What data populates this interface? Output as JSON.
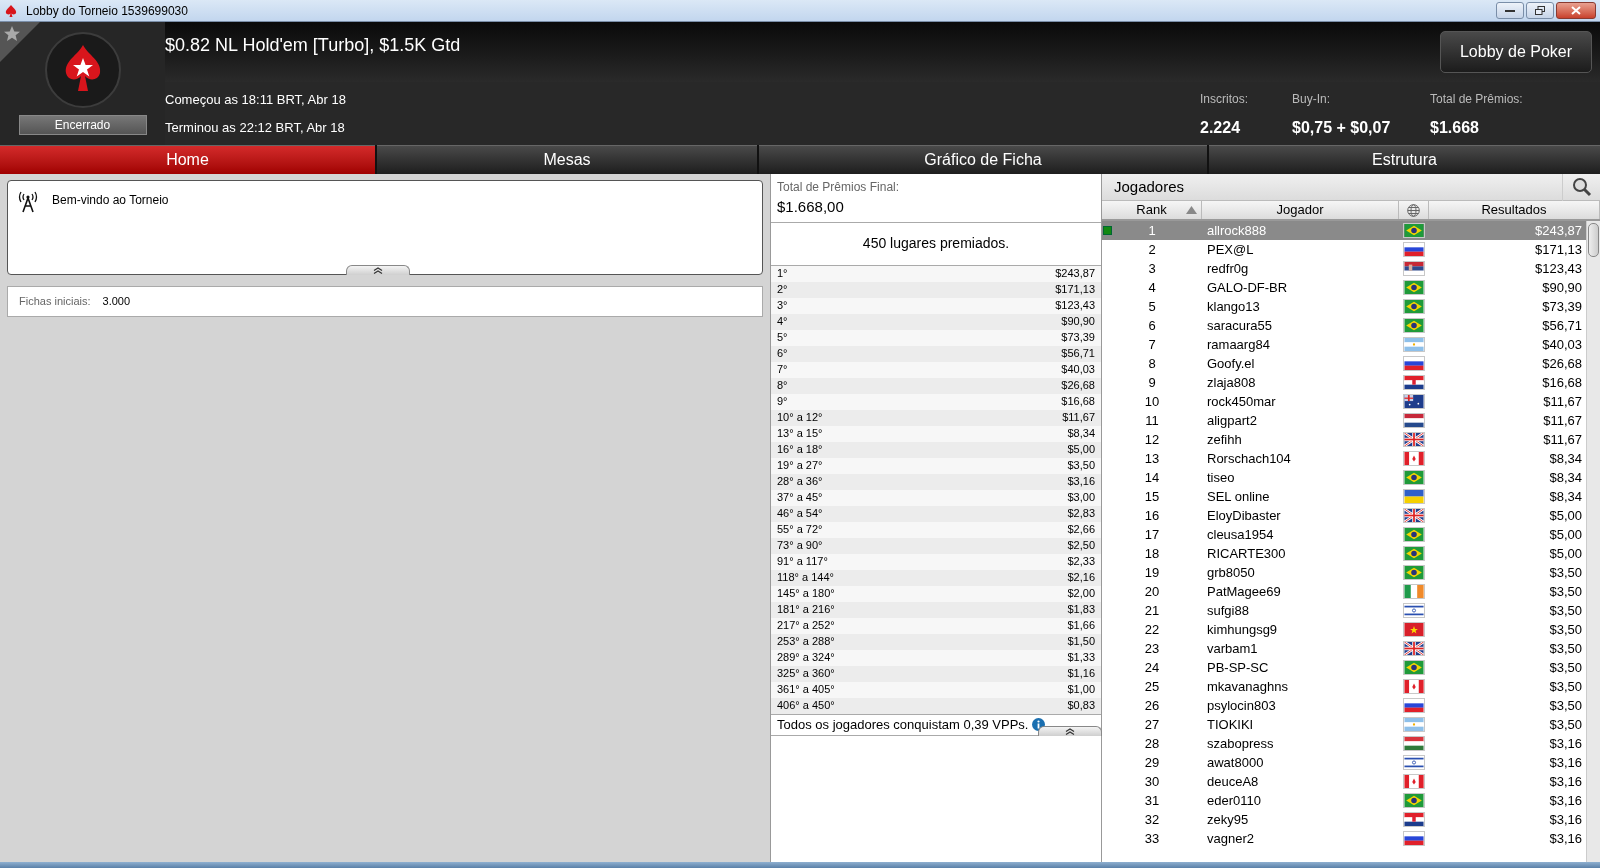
{
  "window": {
    "title": "Lobby do Torneio 1539699030"
  },
  "header": {
    "title": "$0.82 NL Hold'em [Turbo], $1.5K Gtd",
    "status": "Encerrado",
    "started": "Começou as 18:11 BRT, Abr 18",
    "ended": "Terminou as 22:12 BRT, Abr 18",
    "lobby_button": "Lobby de Poker",
    "stats": [
      {
        "label": "Inscritos:",
        "value": "2.224"
      },
      {
        "label": "Buy-In:",
        "value": "$0,75 + $0,07"
      },
      {
        "label": "Total de Prêmios:",
        "value": "$1.668"
      }
    ]
  },
  "tabs": [
    {
      "label": "Home",
      "selected": true
    },
    {
      "label": "Mesas",
      "selected": false
    },
    {
      "label": "Gráfico de Ficha",
      "selected": false
    },
    {
      "label": "Estrutura",
      "selected": false
    }
  ],
  "welcome": {
    "message": "Bem-vindo ao Torneio"
  },
  "starting_chips": {
    "label": "Fichas iniciais:",
    "value": "3.000"
  },
  "prizes": {
    "total_label": "Total de Prêmios Final:",
    "total_value": "$1.668,00",
    "places_text": "450 lugares premiados.",
    "footer": "Todos os jogadores conquistam 0,39 VPPs.",
    "rows": [
      {
        "place": "1°",
        "amount": "$243,87"
      },
      {
        "place": "2°",
        "amount": "$171,13"
      },
      {
        "place": "3°",
        "amount": "$123,43"
      },
      {
        "place": "4°",
        "amount": "$90,90"
      },
      {
        "place": "5°",
        "amount": "$73,39"
      },
      {
        "place": "6°",
        "amount": "$56,71"
      },
      {
        "place": "7°",
        "amount": "$40,03"
      },
      {
        "place": "8°",
        "amount": "$26,68"
      },
      {
        "place": "9°",
        "amount": "$16,68"
      },
      {
        "place": "10° a 12°",
        "amount": "$11,67"
      },
      {
        "place": "13° a 15°",
        "amount": "$8,34"
      },
      {
        "place": "16° a 18°",
        "amount": "$5,00"
      },
      {
        "place": "19° a 27°",
        "amount": "$3,50"
      },
      {
        "place": "28° a 36°",
        "amount": "$3,16"
      },
      {
        "place": "37° a 45°",
        "amount": "$3,00"
      },
      {
        "place": "46° a 54°",
        "amount": "$2,83"
      },
      {
        "place": "55° a 72°",
        "amount": "$2,66"
      },
      {
        "place": "73° a 90°",
        "amount": "$2,50"
      },
      {
        "place": "91° a 117°",
        "amount": "$2,33"
      },
      {
        "place": "118° a 144°",
        "amount": "$2,16"
      },
      {
        "place": "145° a 180°",
        "amount": "$2,00"
      },
      {
        "place": "181° a 216°",
        "amount": "$1,83"
      },
      {
        "place": "217° a 252°",
        "amount": "$1,66"
      },
      {
        "place": "253° a 288°",
        "amount": "$1,50"
      },
      {
        "place": "289° a 324°",
        "amount": "$1,33"
      },
      {
        "place": "325° a 360°",
        "amount": "$1,16"
      },
      {
        "place": "361° a 405°",
        "amount": "$1,00"
      },
      {
        "place": "406° a 450°",
        "amount": "$0,83"
      }
    ]
  },
  "players": {
    "title": "Jogadores",
    "columns": [
      {
        "kind": "text",
        "label": "Rank",
        "sorted": true
      },
      {
        "kind": "text",
        "label": "Jogador",
        "sorted": false
      },
      {
        "kind": "icon",
        "sorted": false
      },
      {
        "kind": "text",
        "label": "Resultados",
        "sorted": false
      }
    ],
    "rows": [
      {
        "rank": "1",
        "name": "allrock888",
        "flag": {
          "kind": "br"
        },
        "result": "$243,87",
        "selected": true
      },
      {
        "rank": "2",
        "name": "PEX@L",
        "flag": {
          "kind": "ru"
        },
        "result": "$171,13",
        "selected": false
      },
      {
        "rank": "3",
        "name": "redfr0g",
        "flag": {
          "kind": "rs"
        },
        "result": "$123,43",
        "selected": false
      },
      {
        "rank": "4",
        "name": "GALO-DF-BR",
        "flag": {
          "kind": "br"
        },
        "result": "$90,90",
        "selected": false
      },
      {
        "rank": "5",
        "name": "klango13",
        "flag": {
          "kind": "br"
        },
        "result": "$73,39",
        "selected": false
      },
      {
        "rank": "6",
        "name": "saracura55",
        "flag": {
          "kind": "br"
        },
        "result": "$56,71",
        "selected": false
      },
      {
        "rank": "7",
        "name": "ramaarg84",
        "flag": {
          "kind": "ar"
        },
        "result": "$40,03",
        "selected": false
      },
      {
        "rank": "8",
        "name": "Goofy.el",
        "flag": {
          "kind": "ru"
        },
        "result": "$26,68",
        "selected": false
      },
      {
        "rank": "9",
        "name": "zlaja808",
        "flag": {
          "kind": "hr"
        },
        "result": "$16,68",
        "selected": false
      },
      {
        "rank": "10",
        "name": "rock450mar",
        "flag": {
          "kind": "au"
        },
        "result": "$11,67",
        "selected": false
      },
      {
        "rank": "11",
        "name": "aligpart2",
        "flag": {
          "kind": "nl"
        },
        "result": "$11,67",
        "selected": false
      },
      {
        "rank": "12",
        "name": "zefihh",
        "flag": {
          "kind": "gb"
        },
        "result": "$11,67",
        "selected": false
      },
      {
        "rank": "13",
        "name": "Rorschach104",
        "flag": {
          "kind": "ca"
        },
        "result": "$8,34",
        "selected": false
      },
      {
        "rank": "14",
        "name": "tiseo",
        "flag": {
          "kind": "br"
        },
        "result": "$8,34",
        "selected": false
      },
      {
        "rank": "15",
        "name": "SEL online",
        "flag": {
          "kind": "ua"
        },
        "result": "$8,34",
        "selected": false
      },
      {
        "rank": "16",
        "name": "EloyDibaster",
        "flag": {
          "kind": "gb"
        },
        "result": "$5,00",
        "selected": false
      },
      {
        "rank": "17",
        "name": "cleusa1954",
        "flag": {
          "kind": "br"
        },
        "result": "$5,00",
        "selected": false
      },
      {
        "rank": "18",
        "name": "RICARTE300",
        "flag": {
          "kind": "br"
        },
        "result": "$5,00",
        "selected": false
      },
      {
        "rank": "19",
        "name": "grb8050",
        "flag": {
          "kind": "br"
        },
        "result": "$3,50",
        "selected": false
      },
      {
        "rank": "20",
        "name": "PatMagee69",
        "flag": {
          "kind": "ie"
        },
        "result": "$3,50",
        "selected": false
      },
      {
        "rank": "21",
        "name": "sufgi88",
        "flag": {
          "kind": "il"
        },
        "result": "$3,50",
        "selected": false
      },
      {
        "rank": "22",
        "name": "kimhungsg9",
        "flag": {
          "kind": "vn"
        },
        "result": "$3,50",
        "selected": false
      },
      {
        "rank": "23",
        "name": "varbam1",
        "flag": {
          "kind": "gb"
        },
        "result": "$3,50",
        "selected": false
      },
      {
        "rank": "24",
        "name": "PB-SP-SC",
        "flag": {
          "kind": "br"
        },
        "result": "$3,50",
        "selected": false
      },
      {
        "rank": "25",
        "name": "mkavanaghns",
        "flag": {
          "kind": "ca"
        },
        "result": "$3,50",
        "selected": false
      },
      {
        "rank": "26",
        "name": "psylocin803",
        "flag": {
          "kind": "ru"
        },
        "result": "$3,50",
        "selected": false
      },
      {
        "rank": "27",
        "name": "TIOKIKI",
        "flag": {
          "kind": "ar"
        },
        "result": "$3,50",
        "selected": false
      },
      {
        "rank": "28",
        "name": "szabopress",
        "flag": {
          "kind": "hu"
        },
        "result": "$3,16",
        "selected": false
      },
      {
        "rank": "29",
        "name": "awat8000",
        "flag": {
          "kind": "il"
        },
        "result": "$3,16",
        "selected": false
      },
      {
        "rank": "30",
        "name": "deuceA8",
        "flag": {
          "kind": "ca"
        },
        "result": "$3,16",
        "selected": false
      },
      {
        "rank": "31",
        "name": "eder0110",
        "flag": {
          "kind": "br"
        },
        "result": "$3,16",
        "selected": false
      },
      {
        "rank": "32",
        "name": "zeky95",
        "flag": {
          "kind": "hr"
        },
        "result": "$3,16",
        "selected": false
      },
      {
        "rank": "33",
        "name": "vagner2",
        "flag": {
          "kind": "ru"
        },
        "result": "$3,16",
        "selected": false
      }
    ]
  }
}
